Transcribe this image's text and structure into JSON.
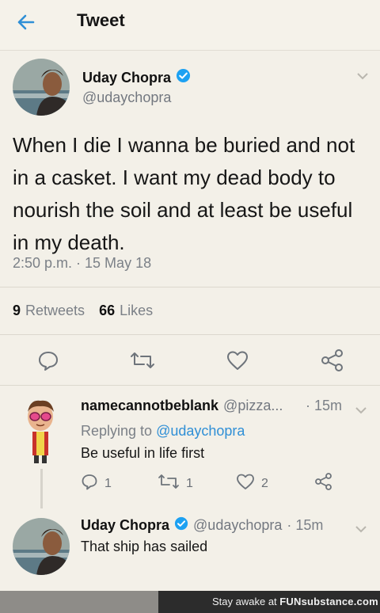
{
  "header": {
    "title": "Tweet"
  },
  "tweet": {
    "author_name": "Uday Chopra",
    "author_handle": "@udaychopra",
    "text": "When I die I wanna be buried and not in a casket. I want my dead body to nourish the soil and at least be useful in my death.",
    "timestamp": "2:50 p.m. · 15 May 18",
    "retweets_count": "9",
    "retweets_label": "Retweets",
    "likes_count": "66",
    "likes_label": "Likes"
  },
  "replies": [
    {
      "author_name": "namecannotbeblank",
      "author_handle": "@pizza...",
      "time": "· 15m",
      "replying_prefix": "Replying to",
      "replying_to": "@udaychopra",
      "text": "Be useful in life first",
      "reply_count": "1",
      "retweet_count": "1",
      "like_count": "2"
    },
    {
      "author_name": "Uday Chopra",
      "author_handle": "@udaychopra",
      "time": "· 15m",
      "text": "That ship has sailed"
    }
  ],
  "watermark": {
    "prefix": "Stay awake at",
    "brand": "FUNsubstance.com"
  },
  "colors": {
    "accent": "#2f8fd6",
    "background": "#f3f0e8",
    "verified": "#1da1f2"
  },
  "icons": [
    "back-arrow-icon",
    "verified-icon",
    "chevron-down-icon",
    "reply-icon",
    "retweet-icon",
    "like-icon",
    "share-icon"
  ]
}
